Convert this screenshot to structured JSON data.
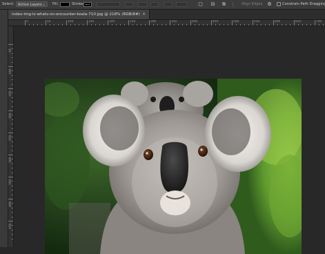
{
  "options_bar": {
    "select_label": "Select:",
    "select_value": "Active Layers",
    "fill_label": "Fill:",
    "fill_color": "#000000",
    "stroke_label": "Stroke:",
    "stroke_color": "#000000",
    "align_edges_label": "Align Edges",
    "constrain_label": "Constrain Path Dragging",
    "constrain_checked": false,
    "icons": [
      "path-operations-icon",
      "path-alignment-icon",
      "path-arrangement-icon",
      "gear-icon"
    ]
  },
  "document": {
    "tab_title": "index-img-lz-whats-on-encounter-koala-710.jpg @ 218% (RGB/8#)",
    "close_glyph": "×"
  },
  "rulers": {
    "top_labels": [
      "0",
      "50",
      "100",
      "150",
      "200",
      "250",
      "300",
      "350",
      "400",
      "450",
      "500",
      "550",
      "600",
      "650",
      "700"
    ],
    "left_labels": [
      "50",
      "100",
      "150",
      "200",
      "250",
      "300",
      "350",
      "400",
      "450"
    ]
  },
  "colors": {
    "workspace": "#282828",
    "panel": "#3b3b3b",
    "accent_text": "#cfcfcf"
  }
}
